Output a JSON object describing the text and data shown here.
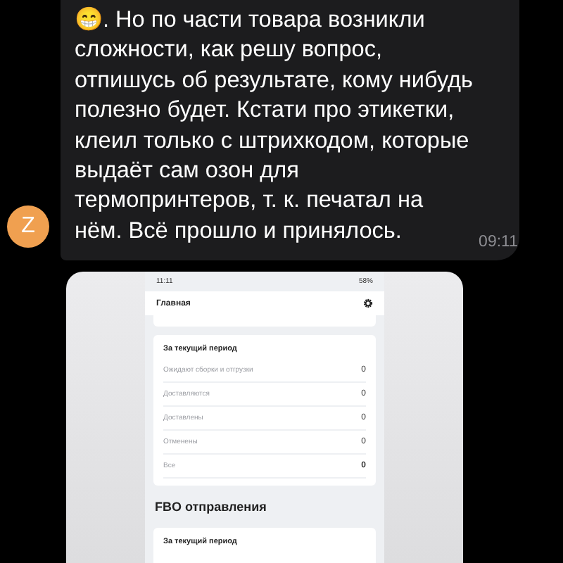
{
  "message": {
    "lines": [
      "😁. Но по части товара возникли",
      "сложности, как решу вопрос,",
      "отпишусь об результате, кому нибудь",
      "полезно будет. Кстати про этикетки,",
      "клеил только с штрихкодом, которые",
      "выдаёт сам озон для",
      "термопринтеров, т. к. печатал на",
      "нём. Всё прошло и принялось."
    ],
    "time": "09:11"
  },
  "avatar": {
    "letter": "Z",
    "color": "#f0a050"
  },
  "screenshot": {
    "status_time": "11:11",
    "battery": "58%",
    "header_title": "Главная",
    "fbs_card": {
      "title": "За текущий период",
      "rows": [
        {
          "label": "Ожидают сборки и отгрузки",
          "value": "0",
          "bold": false
        },
        {
          "label": "Доставляются",
          "value": "0",
          "bold": false
        },
        {
          "label": "Доставлены",
          "value": "0",
          "bold": false
        },
        {
          "label": "Отменены",
          "value": "0",
          "bold": false
        },
        {
          "label": "Все",
          "value": "0",
          "bold": true
        }
      ]
    },
    "fbo_heading": "FBO отправления",
    "fbo_card": {
      "title": "За текущий период"
    }
  }
}
